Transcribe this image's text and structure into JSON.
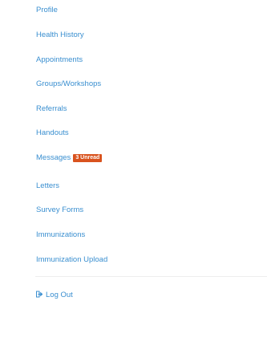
{
  "nav": {
    "items": [
      {
        "label": "Profile"
      },
      {
        "label": "Health History"
      },
      {
        "label": "Appointments"
      },
      {
        "label": "Groups/Workshops"
      },
      {
        "label": "Referrals"
      },
      {
        "label": "Handouts"
      },
      {
        "label": "Messages"
      },
      {
        "label": "Letters"
      },
      {
        "label": "Survey Forms"
      },
      {
        "label": "Immunizations"
      },
      {
        "label": "Immunization Upload"
      }
    ],
    "messages_badge": "3 Unread",
    "logout_label": "Log Out",
    "logout_icon": "sign-out-icon"
  },
  "colors": {
    "link": "#3a8fd0",
    "badge": "#d9531e"
  }
}
